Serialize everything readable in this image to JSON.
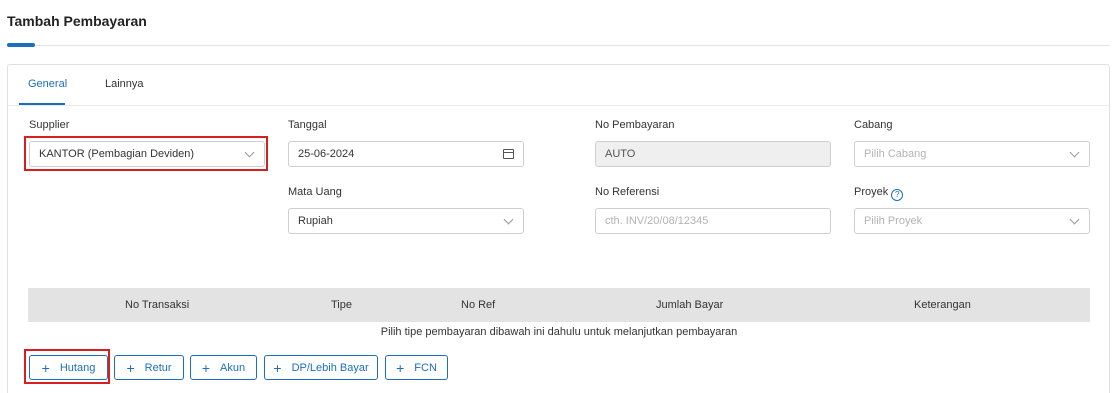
{
  "page": {
    "title": "Tambah Pembayaran"
  },
  "tabs": [
    {
      "label": "General",
      "active": true
    },
    {
      "label": "Lainnya",
      "active": false
    }
  ],
  "form": {
    "supplier": {
      "label": "Supplier",
      "value": "KANTOR (Pembagian Deviden)"
    },
    "tanggal": {
      "label": "Tanggal",
      "value": "25-06-2024"
    },
    "no_pembayaran": {
      "label": "No Pembayaran",
      "value": "AUTO"
    },
    "cabang": {
      "label": "Cabang",
      "placeholder": "Pilih Cabang"
    },
    "mata_uang": {
      "label": "Mata Uang",
      "value": "Rupiah"
    },
    "no_referensi": {
      "label": "No Referensi",
      "placeholder": "cth. INV/20/08/12345"
    },
    "proyek": {
      "label": "Proyek",
      "placeholder": "Pilih Proyek"
    }
  },
  "table": {
    "columns": [
      "No Transaksi",
      "Tipe",
      "No Ref",
      "Jumlah Bayar",
      "Keterangan"
    ],
    "empty_message": "Pilih tipe pembayaran dibawah ini dahulu untuk melanjutkan pembayaran"
  },
  "buttons": [
    {
      "label": "Hutang"
    },
    {
      "label": "Retur"
    },
    {
      "label": "Akun"
    },
    {
      "label": "DP/Lebih Bayar"
    },
    {
      "label": "FCN"
    }
  ],
  "colors": {
    "accent": "#1b6fbf",
    "highlight": "#d71f1f",
    "table_header": "#e3e3e3"
  },
  "icons": {
    "calendar": "calendar-icon",
    "chevron": "chevron-down-icon",
    "help": "help-icon",
    "plus": "plus-icon"
  }
}
